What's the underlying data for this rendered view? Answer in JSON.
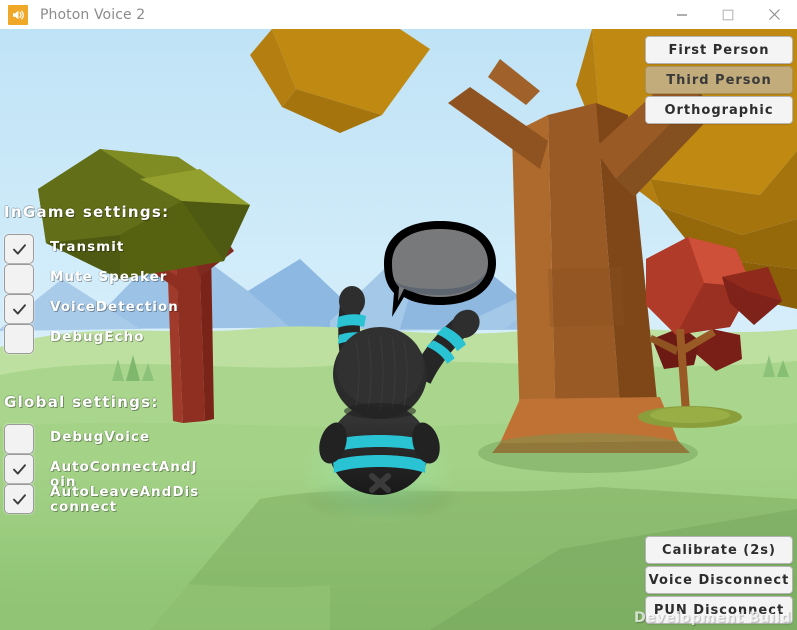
{
  "window": {
    "title": "Photon Voice 2",
    "icon": "speaker-icon",
    "controls": {
      "minimize": "minimize-icon",
      "maximize": "maximize-icon",
      "close": "close-icon"
    }
  },
  "colors": {
    "app_icon_bg": "#f0a828",
    "title_text": "#8b8b8b",
    "button_bg": "#f4f4f4",
    "button_selected_bg": "#c2ac7c",
    "button_text": "#2d2d2d",
    "overlay_label": "#ffffff",
    "sky": "#cfe9f7",
    "ground_near": "#93c777",
    "ground_far": "#b8dd96",
    "mountain": "#8fb8e0",
    "tree_trunk_big": "#9a5a25",
    "tree_canopy_gold": "#c08a12",
    "tree_canopy_olive": "#6e7a1d",
    "tree_trunk_red": "#8e2f22",
    "tree_foliage_red": "#c0442f",
    "character_body": "#262626",
    "character_stripe": "#29c3d4",
    "speech_bubble_fill": "#77797b",
    "speech_bubble_stroke": "#000000"
  },
  "overlay": {
    "ingame": {
      "title": "InGame settings:",
      "items": [
        {
          "label": "Transmit",
          "checked": true
        },
        {
          "label": "Mute Speaker",
          "checked": false
        },
        {
          "label": "VoiceDetection",
          "checked": true
        },
        {
          "label": "DebugEcho",
          "checked": false
        }
      ]
    },
    "global": {
      "title": "Global settings:",
      "items": [
        {
          "label": "DebugVoice",
          "checked": false
        },
        {
          "label": "AutoConnectAndJoin",
          "checked": true
        },
        {
          "label": "AutoLeaveAndDisconnect",
          "checked": true
        }
      ]
    },
    "camera_buttons": [
      {
        "label": "First Person",
        "selected": false
      },
      {
        "label": "Third Person",
        "selected": true
      },
      {
        "label": "Orthographic",
        "selected": false
      }
    ],
    "action_buttons": [
      {
        "label": "Calibrate (2s)"
      },
      {
        "label": "Voice Disconnect"
      },
      {
        "label": "PUN Disconnect"
      }
    ],
    "watermark": "Development Build"
  }
}
